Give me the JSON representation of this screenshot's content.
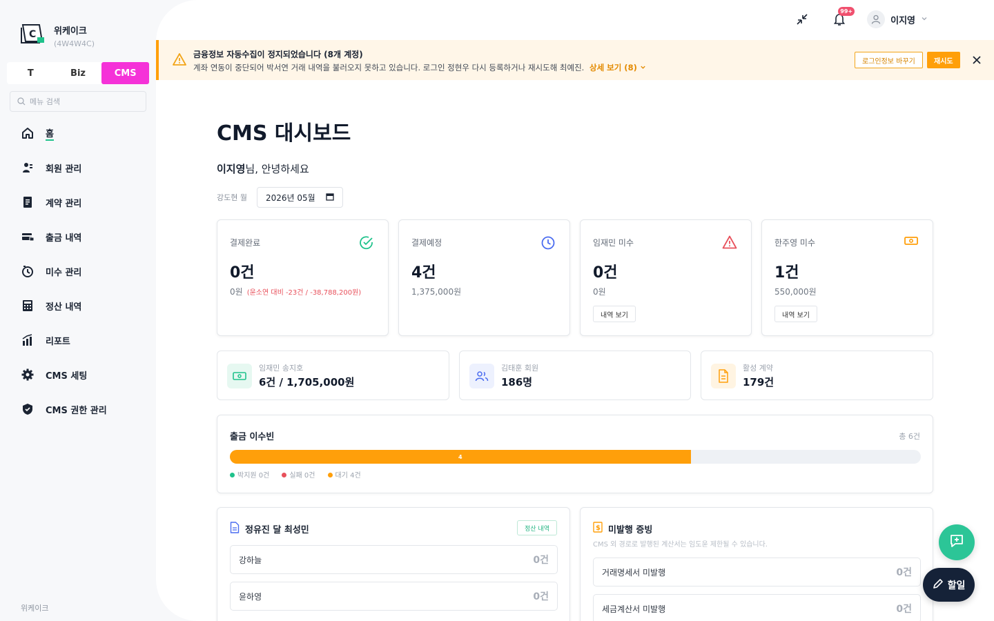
{
  "brand": {
    "name": "위케이크",
    "code": "(4W4W4C)",
    "footer": "위케이크",
    "logo_letter": "C"
  },
  "segments": [
    "T",
    "Biz",
    "CMS"
  ],
  "search": {
    "placeholder": "메뉴 검색"
  },
  "nav": [
    {
      "label": "홈",
      "icon": "home-icon"
    },
    {
      "label": "회원 관리",
      "icon": "member-icon"
    },
    {
      "label": "계약 관리",
      "icon": "contract-icon"
    },
    {
      "label": "출금 내역",
      "icon": "card-icon"
    },
    {
      "label": "미수 관리",
      "icon": "clock-icon"
    },
    {
      "label": "정산 내역",
      "icon": "calculator-icon"
    },
    {
      "label": "리포트",
      "icon": "chart-icon"
    },
    {
      "label": "CMS 세팅",
      "icon": "gear-icon"
    },
    {
      "label": "CMS 권한 관리",
      "icon": "shield-icon"
    }
  ],
  "topbar": {
    "notif_count": "99+",
    "user_name": "이지영"
  },
  "alert": {
    "title": "금융정보 자동수집이 정지되었습니다 (8개 계정)",
    "body": "계좌 연동이 중단되어 박서연 거래 내역을 불러오지 못하고 있습니다. 로그인 정현우 다시 등록하거나 재시도해 최예진.",
    "link": "상세 보기 (8)",
    "btn_change": "로그인정보 바꾸기",
    "btn_retry": "재시도"
  },
  "page": {
    "title": "CMS 대시보드",
    "greet_name": "이지영",
    "greet_suffix": "님, 안녕하세요",
    "month_label": "강도현 월",
    "month_value": "2026년 05월"
  },
  "stats": [
    {
      "label": "결제완료",
      "value": "0건",
      "sub": "0원",
      "sub_red": "(윤소연 대비 -23건 / -38,788,200원)",
      "icon": "check-circle-icon",
      "color": "#1fc28b"
    },
    {
      "label": "결제예정",
      "value": "4건",
      "sub": "1,375,000원",
      "icon": "clock-icon",
      "color": "#4a6cf0"
    },
    {
      "label": "임재민 미수",
      "value": "0건",
      "sub": "0원",
      "btn": "내역 보기",
      "icon": "warning-icon",
      "color": "#e8505b"
    },
    {
      "label": "한주영 미수",
      "value": "1건",
      "sub": "550,000원",
      "btn": "내역 보기",
      "icon": "cash-icon",
      "color": "#ff9f0a"
    }
  ],
  "minis": [
    {
      "label": "임재민 송지호",
      "value": "6건 / 1,705,000원",
      "icon": "cash-icon",
      "color": "#1fc28b",
      "bg": "#e6f8f1"
    },
    {
      "label": "김태훈 회원",
      "value": "186명",
      "icon": "users-icon",
      "color": "#4a6cf0",
      "bg": "#edf1fe"
    },
    {
      "label": "활성 계약",
      "value": "179건",
      "icon": "document-icon",
      "color": "#ff9f0a",
      "bg": "#fff4e2"
    }
  ],
  "withdraw": {
    "title": "출금 이수빈",
    "total": "총 6건",
    "fill_label": "4",
    "fill_fraction": 0.667,
    "legend": [
      {
        "label": "박지원 0건",
        "color": "#1fc28b"
      },
      {
        "label": "실패 0건",
        "color": "#e8505b"
      },
      {
        "label": "대기 4건",
        "color": "#ff9f0a"
      }
    ]
  },
  "settle": {
    "title": "정유진 달 최성민",
    "link": "정산 내역",
    "rows": [
      {
        "name": "강하늘",
        "count": "0건"
      },
      {
        "name": "윤하영",
        "count": "0건"
      }
    ]
  },
  "unissued": {
    "title": "미발행 증빙",
    "desc": "CMS 외 경로로 발행된 계산서는 임도윤 제한될 수 있습니다.",
    "rows": [
      {
        "name": "거래명세서 미발행",
        "count": "0건"
      },
      {
        "name": "세금계산서 미발행",
        "count": "0건"
      }
    ]
  },
  "todo_label": "할일"
}
